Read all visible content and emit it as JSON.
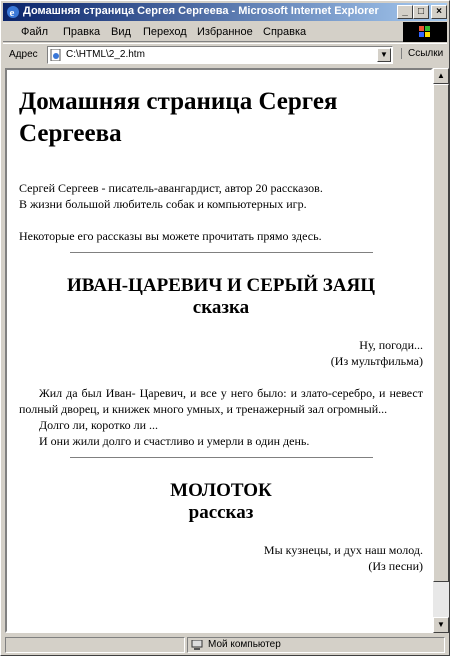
{
  "window": {
    "title": "Домашняя страница Сергея Сергеева - Microsoft Internet Explorer",
    "minimize": "_",
    "maximize": "□",
    "close": "×"
  },
  "menu": {
    "items": [
      "Файл",
      "Правка",
      "Вид",
      "Переход",
      "Избранное",
      "Справка"
    ]
  },
  "address": {
    "label": "Адрес",
    "value": "C:\\HTML\\2_2.htm",
    "links": "Ссылки"
  },
  "page": {
    "heading": "Домашняя страница Сергея Сергеева",
    "intro_1": "Сергей Сергеев - писатель-авангардист, автор 20 рассказов.",
    "intro_2": "В жизни большой любитель собак и компьютерных игр.",
    "intro_3": "Некоторые его рассказы вы можете прочитать прямо здесь.",
    "story1": {
      "title": "ИВАН-ЦАРЕВИЧ И СЕРЫЙ ЗАЯЦ",
      "genre": "сказка",
      "epigraph": "Ну, погоди...",
      "epigraph_src": "(Из мультфильма)",
      "para": "Жил да был Иван- Царевич, и все у него было: и злато-серебро, и невест полный дворец, и книжек много умных, и тренажерный зал огромный...",
      "line2": "Долго ли, коротко ли ...",
      "line3": "И они жили долго и счастливо и умерли в один день."
    },
    "story2": {
      "title": "МОЛОТОК",
      "genre": "рассказ",
      "epigraph": "Мы кузнецы, и дух наш молод.",
      "epigraph_src": "(Из песни)"
    }
  },
  "status": {
    "zone": "Мой компьютер"
  },
  "colors": {
    "title_start": "#0a246a",
    "title_end": "#a6caf0",
    "chrome": "#d4d0c8"
  }
}
